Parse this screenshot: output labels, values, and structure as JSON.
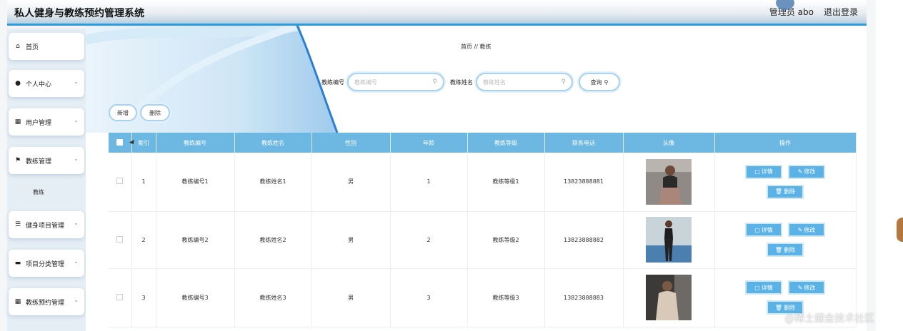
{
  "header": {
    "title": "私人健身与教练预约管理系统",
    "user": "管理员 abo",
    "logout": "退出登录"
  },
  "sidebar": {
    "items": [
      {
        "label": "首页",
        "icon": "home-icon",
        "glyph": "⌂"
      },
      {
        "label": "个人中心",
        "icon": "user-icon",
        "glyph": "👤"
      },
      {
        "label": "用户管理",
        "icon": "grid-icon",
        "glyph": "▦"
      },
      {
        "label": "教练管理",
        "icon": "flag-icon",
        "glyph": "⚑"
      },
      {
        "label": "教练",
        "icon": "",
        "glyph": ""
      },
      {
        "label": "健身项目管理",
        "icon": "list-icon",
        "glyph": "☰"
      },
      {
        "label": "项目分类管理",
        "icon": "folder-icon",
        "glyph": "▬"
      },
      {
        "label": "教练预约管理",
        "icon": "grid-icon",
        "glyph": "▦"
      }
    ]
  },
  "breadcrumb": "首页 // 教练",
  "search": {
    "label1": "教练编号",
    "placeholder1": "教练编号",
    "value1": "",
    "label2": "教练姓名",
    "placeholder2": "教练姓名",
    "value2": "",
    "query": "查询"
  },
  "actions": {
    "add": "新增",
    "delete": "删除"
  },
  "table": {
    "headers": [
      "索引",
      "教练编号",
      "教练姓名",
      "性别",
      "年龄",
      "教练等级",
      "联系电话",
      "头像",
      "操作"
    ],
    "rows": [
      {
        "index": "1",
        "code": "教练编号1",
        "name": "教练姓名1",
        "gender": "男",
        "age": "1",
        "level": "教练等级1",
        "phone": "13823888881"
      },
      {
        "index": "2",
        "code": "教练编号2",
        "name": "教练姓名2",
        "gender": "男",
        "age": "2",
        "level": "教练等级2",
        "phone": "13823888882"
      },
      {
        "index": "3",
        "code": "教练编号3",
        "name": "教练姓名3",
        "gender": "男",
        "age": "3",
        "level": "教练等级3",
        "phone": "13823888883"
      }
    ],
    "ops": {
      "detail": "详情",
      "edit": "修改",
      "delete": "删除"
    }
  },
  "colors": {
    "accent": "#2b9be0",
    "table_header": "#6db8e2",
    "op_button": "#5bb2e6"
  },
  "watermark": "@稀土掘金技术社区"
}
